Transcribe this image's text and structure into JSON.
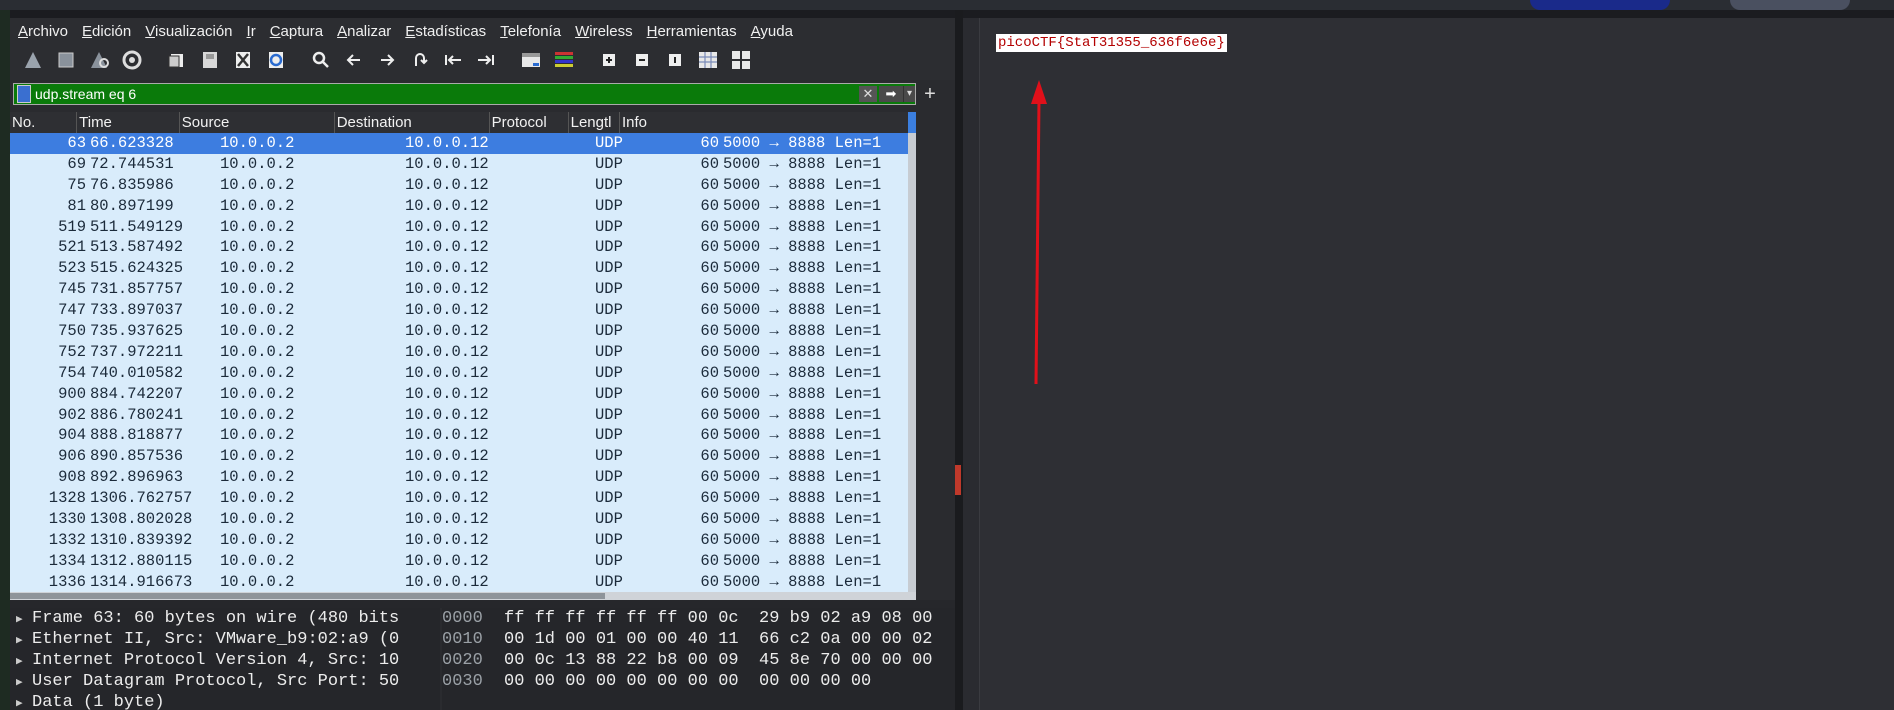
{
  "menubar": [
    "Archivo",
    "Edición",
    "Visualización",
    "Ir",
    "Captura",
    "Analizar",
    "Estadísticas",
    "Telefonía",
    "Wireless",
    "Herramientas",
    "Ayuda"
  ],
  "toolbar": [
    "shark-fin-start-icon",
    "stop-capture-icon",
    "restart-capture-icon",
    "capture-options-icon",
    "open-file-icon",
    "save-file-icon",
    "close-file-icon",
    "reload-file-icon",
    "find-packet-icon",
    "go-back-icon",
    "go-forward-icon",
    "go-to-packet-icon",
    "first-packet-icon",
    "last-packet-icon",
    "autoscroll-icon",
    "colorize-icon",
    "zoom-in-icon",
    "zoom-out-icon",
    "normal-size-icon",
    "resize-columns-icon",
    "split-view-icon"
  ],
  "filter": {
    "value": "udp.stream eq 6",
    "clear": "✕",
    "apply": "➡",
    "dropdown": "▾",
    "add": "+"
  },
  "columns": [
    "No.",
    "Time",
    "Source",
    "Destination",
    "Protocol",
    "Lengtl",
    "Info"
  ],
  "rows": [
    {
      "no": "63",
      "time": "66.623328",
      "src": "10.0.0.2",
      "dst": "10.0.0.12",
      "proto": "UDP",
      "len": "60",
      "info": "5000 → 8888 Len=1",
      "selected": true
    },
    {
      "no": "69",
      "time": "72.744531",
      "src": "10.0.0.2",
      "dst": "10.0.0.12",
      "proto": "UDP",
      "len": "60",
      "info": "5000 → 8888 Len=1"
    },
    {
      "no": "75",
      "time": "76.835986",
      "src": "10.0.0.2",
      "dst": "10.0.0.12",
      "proto": "UDP",
      "len": "60",
      "info": "5000 → 8888 Len=1"
    },
    {
      "no": "81",
      "time": "80.897199",
      "src": "10.0.0.2",
      "dst": "10.0.0.12",
      "proto": "UDP",
      "len": "60",
      "info": "5000 → 8888 Len=1"
    },
    {
      "no": "519",
      "time": "511.549129",
      "src": "10.0.0.2",
      "dst": "10.0.0.12",
      "proto": "UDP",
      "len": "60",
      "info": "5000 → 8888 Len=1"
    },
    {
      "no": "521",
      "time": "513.587492",
      "src": "10.0.0.2",
      "dst": "10.0.0.12",
      "proto": "UDP",
      "len": "60",
      "info": "5000 → 8888 Len=1"
    },
    {
      "no": "523",
      "time": "515.624325",
      "src": "10.0.0.2",
      "dst": "10.0.0.12",
      "proto": "UDP",
      "len": "60",
      "info": "5000 → 8888 Len=1"
    },
    {
      "no": "745",
      "time": "731.857757",
      "src": "10.0.0.2",
      "dst": "10.0.0.12",
      "proto": "UDP",
      "len": "60",
      "info": "5000 → 8888 Len=1"
    },
    {
      "no": "747",
      "time": "733.897037",
      "src": "10.0.0.2",
      "dst": "10.0.0.12",
      "proto": "UDP",
      "len": "60",
      "info": "5000 → 8888 Len=1"
    },
    {
      "no": "750",
      "time": "735.937625",
      "src": "10.0.0.2",
      "dst": "10.0.0.12",
      "proto": "UDP",
      "len": "60",
      "info": "5000 → 8888 Len=1"
    },
    {
      "no": "752",
      "time": "737.972211",
      "src": "10.0.0.2",
      "dst": "10.0.0.12",
      "proto": "UDP",
      "len": "60",
      "info": "5000 → 8888 Len=1"
    },
    {
      "no": "754",
      "time": "740.010582",
      "src": "10.0.0.2",
      "dst": "10.0.0.12",
      "proto": "UDP",
      "len": "60",
      "info": "5000 → 8888 Len=1"
    },
    {
      "no": "900",
      "time": "884.742207",
      "src": "10.0.0.2",
      "dst": "10.0.0.12",
      "proto": "UDP",
      "len": "60",
      "info": "5000 → 8888 Len=1"
    },
    {
      "no": "902",
      "time": "886.780241",
      "src": "10.0.0.2",
      "dst": "10.0.0.12",
      "proto": "UDP",
      "len": "60",
      "info": "5000 → 8888 Len=1"
    },
    {
      "no": "904",
      "time": "888.818877",
      "src": "10.0.0.2",
      "dst": "10.0.0.12",
      "proto": "UDP",
      "len": "60",
      "info": "5000 → 8888 Len=1"
    },
    {
      "no": "906",
      "time": "890.857536",
      "src": "10.0.0.2",
      "dst": "10.0.0.12",
      "proto": "UDP",
      "len": "60",
      "info": "5000 → 8888 Len=1"
    },
    {
      "no": "908",
      "time": "892.896963",
      "src": "10.0.0.2",
      "dst": "10.0.0.12",
      "proto": "UDP",
      "len": "60",
      "info": "5000 → 8888 Len=1"
    },
    {
      "no": "1328",
      "time": "1306.762757",
      "src": "10.0.0.2",
      "dst": "10.0.0.12",
      "proto": "UDP",
      "len": "60",
      "info": "5000 → 8888 Len=1"
    },
    {
      "no": "1330",
      "time": "1308.802028",
      "src": "10.0.0.2",
      "dst": "10.0.0.12",
      "proto": "UDP",
      "len": "60",
      "info": "5000 → 8888 Len=1"
    },
    {
      "no": "1332",
      "time": "1310.839392",
      "src": "10.0.0.2",
      "dst": "10.0.0.12",
      "proto": "UDP",
      "len": "60",
      "info": "5000 → 8888 Len=1"
    },
    {
      "no": "1334",
      "time": "1312.880115",
      "src": "10.0.0.2",
      "dst": "10.0.0.12",
      "proto": "UDP",
      "len": "60",
      "info": "5000 → 8888 Len=1"
    },
    {
      "no": "1336",
      "time": "1314.916673",
      "src": "10.0.0.2",
      "dst": "10.0.0.12",
      "proto": "UDP",
      "len": "60",
      "info": "5000 → 8888 Len=1"
    }
  ],
  "details": [
    "Frame 63: 60 bytes on wire (480 bits",
    "Ethernet II, Src: VMware_b9:02:a9 (0",
    "Internet Protocol Version 4, Src: 10",
    "User Datagram Protocol, Src Port: 50",
    "Data (1 byte)"
  ],
  "bytes": [
    {
      "offset": "0000",
      "hex": "ff ff ff ff ff ff 00 0c  29 b9 02 a9 08 00"
    },
    {
      "offset": "0010",
      "hex": "00 1d 00 01 00 00 40 11  66 c2 0a 00 00 02"
    },
    {
      "offset": "0020",
      "hex": "00 0c 13 88 22 b8 00 09  45 8e 70 00 00 00"
    },
    {
      "offset": "0030",
      "hex": "00 00 00 00 00 00 00 00  00 00 00 00"
    }
  ],
  "note": {
    "flag": "picoCTF{StaT31355_636f6e6e}"
  },
  "colors": {
    "selected_row": "#3d7de0",
    "row_bg": "#d9ecfb",
    "filter_ok": "#0a7a0a",
    "arrow": "#e0101a"
  }
}
